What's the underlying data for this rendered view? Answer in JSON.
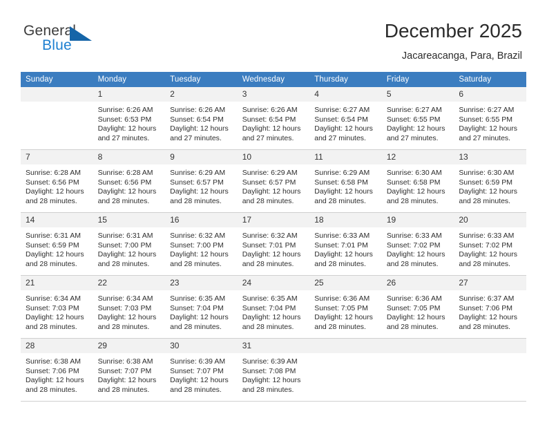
{
  "brand": {
    "name_part1": "General",
    "name_part2": "Blue",
    "flag_icon": "blue-flag-icon",
    "colors": {
      "blue": "#1d7fd0",
      "flag": "#1565a8",
      "dark": "#3b3b3b"
    }
  },
  "header": {
    "title": "December 2025",
    "subtitle": "Jacareacanga, Para, Brazil"
  },
  "calendar": {
    "header_background": "#3b7dc0",
    "daynum_background": "#f2f2f2",
    "weekdays": [
      "Sunday",
      "Monday",
      "Tuesday",
      "Wednesday",
      "Thursday",
      "Friday",
      "Saturday"
    ],
    "weeks": [
      [
        {
          "day": "",
          "sunrise": "",
          "sunset": "",
          "daylight": "",
          "empty": true
        },
        {
          "day": "1",
          "sunrise": "Sunrise: 6:26 AM",
          "sunset": "Sunset: 6:53 PM",
          "daylight": "Daylight: 12 hours and 27 minutes."
        },
        {
          "day": "2",
          "sunrise": "Sunrise: 6:26 AM",
          "sunset": "Sunset: 6:54 PM",
          "daylight": "Daylight: 12 hours and 27 minutes."
        },
        {
          "day": "3",
          "sunrise": "Sunrise: 6:26 AM",
          "sunset": "Sunset: 6:54 PM",
          "daylight": "Daylight: 12 hours and 27 minutes."
        },
        {
          "day": "4",
          "sunrise": "Sunrise: 6:27 AM",
          "sunset": "Sunset: 6:54 PM",
          "daylight": "Daylight: 12 hours and 27 minutes."
        },
        {
          "day": "5",
          "sunrise": "Sunrise: 6:27 AM",
          "sunset": "Sunset: 6:55 PM",
          "daylight": "Daylight: 12 hours and 27 minutes."
        },
        {
          "day": "6",
          "sunrise": "Sunrise: 6:27 AM",
          "sunset": "Sunset: 6:55 PM",
          "daylight": "Daylight: 12 hours and 27 minutes."
        }
      ],
      [
        {
          "day": "7",
          "sunrise": "Sunrise: 6:28 AM",
          "sunset": "Sunset: 6:56 PM",
          "daylight": "Daylight: 12 hours and 28 minutes."
        },
        {
          "day": "8",
          "sunrise": "Sunrise: 6:28 AM",
          "sunset": "Sunset: 6:56 PM",
          "daylight": "Daylight: 12 hours and 28 minutes."
        },
        {
          "day": "9",
          "sunrise": "Sunrise: 6:29 AM",
          "sunset": "Sunset: 6:57 PM",
          "daylight": "Daylight: 12 hours and 28 minutes."
        },
        {
          "day": "10",
          "sunrise": "Sunrise: 6:29 AM",
          "sunset": "Sunset: 6:57 PM",
          "daylight": "Daylight: 12 hours and 28 minutes."
        },
        {
          "day": "11",
          "sunrise": "Sunrise: 6:29 AM",
          "sunset": "Sunset: 6:58 PM",
          "daylight": "Daylight: 12 hours and 28 minutes."
        },
        {
          "day": "12",
          "sunrise": "Sunrise: 6:30 AM",
          "sunset": "Sunset: 6:58 PM",
          "daylight": "Daylight: 12 hours and 28 minutes."
        },
        {
          "day": "13",
          "sunrise": "Sunrise: 6:30 AM",
          "sunset": "Sunset: 6:59 PM",
          "daylight": "Daylight: 12 hours and 28 minutes."
        }
      ],
      [
        {
          "day": "14",
          "sunrise": "Sunrise: 6:31 AM",
          "sunset": "Sunset: 6:59 PM",
          "daylight": "Daylight: 12 hours and 28 minutes."
        },
        {
          "day": "15",
          "sunrise": "Sunrise: 6:31 AM",
          "sunset": "Sunset: 7:00 PM",
          "daylight": "Daylight: 12 hours and 28 minutes."
        },
        {
          "day": "16",
          "sunrise": "Sunrise: 6:32 AM",
          "sunset": "Sunset: 7:00 PM",
          "daylight": "Daylight: 12 hours and 28 minutes."
        },
        {
          "day": "17",
          "sunrise": "Sunrise: 6:32 AM",
          "sunset": "Sunset: 7:01 PM",
          "daylight": "Daylight: 12 hours and 28 minutes."
        },
        {
          "day": "18",
          "sunrise": "Sunrise: 6:33 AM",
          "sunset": "Sunset: 7:01 PM",
          "daylight": "Daylight: 12 hours and 28 minutes."
        },
        {
          "day": "19",
          "sunrise": "Sunrise: 6:33 AM",
          "sunset": "Sunset: 7:02 PM",
          "daylight": "Daylight: 12 hours and 28 minutes."
        },
        {
          "day": "20",
          "sunrise": "Sunrise: 6:33 AM",
          "sunset": "Sunset: 7:02 PM",
          "daylight": "Daylight: 12 hours and 28 minutes."
        }
      ],
      [
        {
          "day": "21",
          "sunrise": "Sunrise: 6:34 AM",
          "sunset": "Sunset: 7:03 PM",
          "daylight": "Daylight: 12 hours and 28 minutes."
        },
        {
          "day": "22",
          "sunrise": "Sunrise: 6:34 AM",
          "sunset": "Sunset: 7:03 PM",
          "daylight": "Daylight: 12 hours and 28 minutes."
        },
        {
          "day": "23",
          "sunrise": "Sunrise: 6:35 AM",
          "sunset": "Sunset: 7:04 PM",
          "daylight": "Daylight: 12 hours and 28 minutes."
        },
        {
          "day": "24",
          "sunrise": "Sunrise: 6:35 AM",
          "sunset": "Sunset: 7:04 PM",
          "daylight": "Daylight: 12 hours and 28 minutes."
        },
        {
          "day": "25",
          "sunrise": "Sunrise: 6:36 AM",
          "sunset": "Sunset: 7:05 PM",
          "daylight": "Daylight: 12 hours and 28 minutes."
        },
        {
          "day": "26",
          "sunrise": "Sunrise: 6:36 AM",
          "sunset": "Sunset: 7:05 PM",
          "daylight": "Daylight: 12 hours and 28 minutes."
        },
        {
          "day": "27",
          "sunrise": "Sunrise: 6:37 AM",
          "sunset": "Sunset: 7:06 PM",
          "daylight": "Daylight: 12 hours and 28 minutes."
        }
      ],
      [
        {
          "day": "28",
          "sunrise": "Sunrise: 6:38 AM",
          "sunset": "Sunset: 7:06 PM",
          "daylight": "Daylight: 12 hours and 28 minutes."
        },
        {
          "day": "29",
          "sunrise": "Sunrise: 6:38 AM",
          "sunset": "Sunset: 7:07 PM",
          "daylight": "Daylight: 12 hours and 28 minutes."
        },
        {
          "day": "30",
          "sunrise": "Sunrise: 6:39 AM",
          "sunset": "Sunset: 7:07 PM",
          "daylight": "Daylight: 12 hours and 28 minutes."
        },
        {
          "day": "31",
          "sunrise": "Sunrise: 6:39 AM",
          "sunset": "Sunset: 7:08 PM",
          "daylight": "Daylight: 12 hours and 28 minutes."
        },
        {
          "day": "",
          "sunrise": "",
          "sunset": "",
          "daylight": "",
          "empty": true
        },
        {
          "day": "",
          "sunrise": "",
          "sunset": "",
          "daylight": "",
          "empty": true
        },
        {
          "day": "",
          "sunrise": "",
          "sunset": "",
          "daylight": "",
          "empty": true
        }
      ]
    ]
  }
}
